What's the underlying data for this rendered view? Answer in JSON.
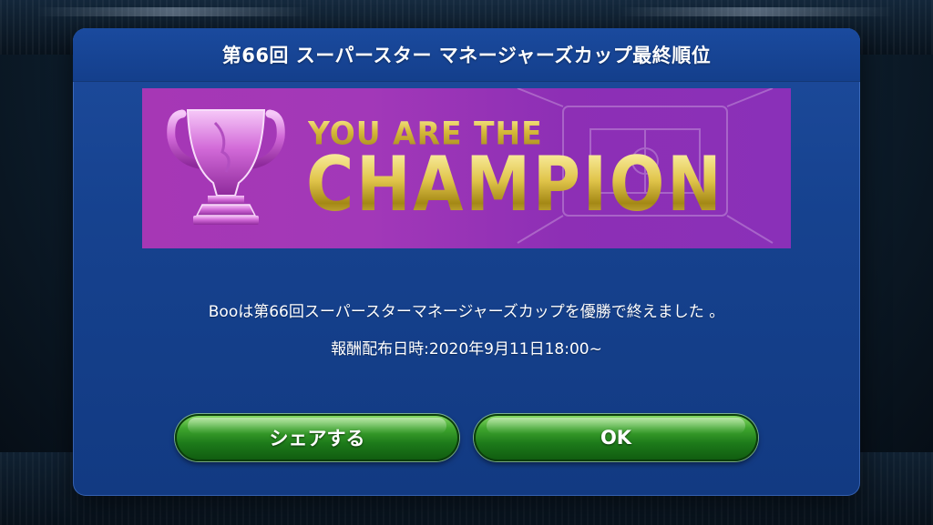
{
  "dialog": {
    "title": "第66回 スーパースター マネージャーズカップ最終順位"
  },
  "banner": {
    "line1": "YOU ARE THE",
    "line2": "CHAMPION",
    "trophy_icon": "trophy-icon"
  },
  "body": {
    "message": "Booは第66回スーパースターマネージャーズカップを優勝で終えました 。",
    "reward": "報酬配布日時:2020年9月11日18:00~"
  },
  "buttons": {
    "share_label": "シェアする",
    "ok_label": "OK"
  },
  "colors": {
    "dialog_bg": "#16428f",
    "banner_bg": "#a238b8",
    "button_green": "#2f9a26",
    "gold": "#d6b93a"
  }
}
